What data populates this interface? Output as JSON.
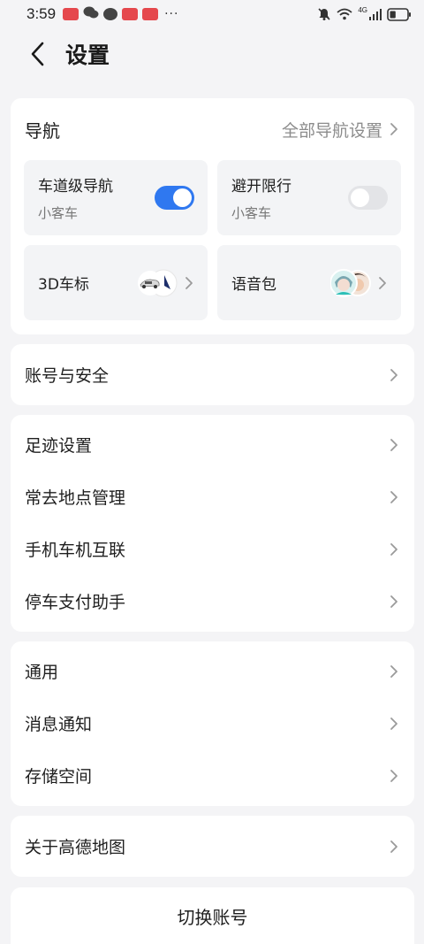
{
  "status_bar": {
    "time": "3:59",
    "overflow": "···",
    "network_label": "4G",
    "battery_level": 0.35,
    "icons": [
      "app-icon",
      "wechat-icon",
      "message-icon",
      "app-icon",
      "app-icon",
      "mute-icon",
      "wifi-icon",
      "signal-icon",
      "battery-icon"
    ]
  },
  "header": {
    "back_icon": "chevron-left-icon",
    "title": "设置"
  },
  "navigation": {
    "title": "导航",
    "all_settings": "全部导航设置",
    "tiles": [
      {
        "label": "车道级导航",
        "sub": "小客车",
        "toggle": true
      },
      {
        "label": "避开限行",
        "sub": "小客车",
        "toggle": false
      },
      {
        "label": "3D车标",
        "icon": "car-marker-icon"
      },
      {
        "label": "语音包",
        "icon": "voice-avatar-icon"
      }
    ]
  },
  "sections": [
    {
      "items": [
        "账号与安全"
      ]
    },
    {
      "items": [
        "足迹设置",
        "常去地点管理",
        "手机车机互联",
        "停车支付助手"
      ]
    },
    {
      "items": [
        "通用",
        "消息通知",
        "存储空间"
      ]
    },
    {
      "items": [
        "关于高德地图"
      ]
    }
  ],
  "footer": {
    "switch_account": "切换账号"
  },
  "colors": {
    "accent": "#2f78f0",
    "background": "#f4f4f6",
    "card": "#ffffff",
    "tile": "#f3f4f6",
    "secondary_text": "#8c8c8c"
  }
}
